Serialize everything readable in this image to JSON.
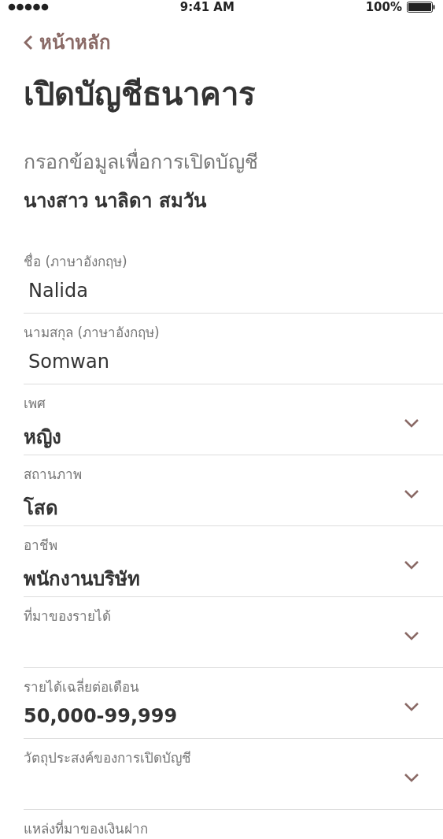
{
  "status_bar": {
    "time": "9:41 AM",
    "battery": "100%"
  },
  "back": {
    "label": "หน้าหลัก"
  },
  "title": "เปิดบัญชีธนาคาร",
  "subtitle": "กรอกข้อมูลเพื่อการเปิดบัญชี",
  "customer_name": "นางสาว นาลิดา สมวัน",
  "fields": [
    {
      "kind": "text",
      "label": "ชื่อ (ภาษาอังกฤษ)",
      "value": "Nalida"
    },
    {
      "kind": "text",
      "label": "นามสกุล (ภาษาอังกฤษ)",
      "value": "Somwan"
    },
    {
      "kind": "select",
      "label": "เพศ",
      "value": "หญิง"
    },
    {
      "kind": "select",
      "label": "สถานภาพ",
      "value": "โสด"
    },
    {
      "kind": "select",
      "label": "อาชีพ",
      "value": "พนักงานบริษัท"
    },
    {
      "kind": "select",
      "label": "ที่มาของรายได้"
    },
    {
      "kind": "select",
      "label": "รายได้เฉลี่ยต่อเดือน",
      "value": "50,000-99,999"
    },
    {
      "kind": "select",
      "label": "วัตถุประสงค์ของการเปิดบัญชี"
    },
    {
      "kind": "partial",
      "label": "แหล่งที่มาของเงินฝาก"
    }
  ]
}
